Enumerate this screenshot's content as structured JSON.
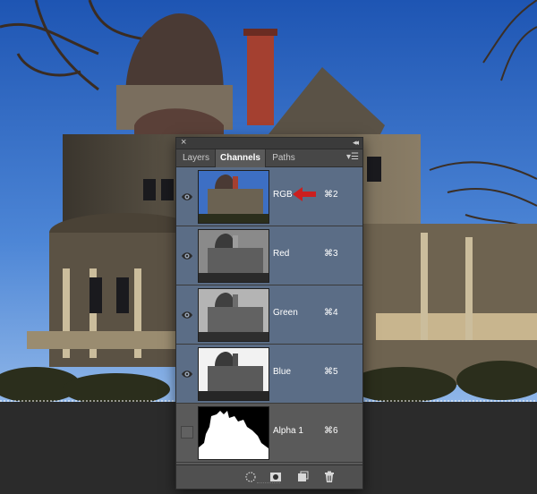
{
  "panel": {
    "tabs": [
      {
        "label": "Layers",
        "active": false
      },
      {
        "label": "Channels",
        "active": true
      },
      {
        "label": "Paths",
        "active": false
      }
    ],
    "channels": [
      {
        "name": "RGB",
        "shortcut": "⌘2",
        "visible": true,
        "selected": true
      },
      {
        "name": "Red",
        "shortcut": "⌘3",
        "visible": true,
        "selected": true
      },
      {
        "name": "Green",
        "shortcut": "⌘4",
        "visible": true,
        "selected": true
      },
      {
        "name": "Blue",
        "shortcut": "⌘5",
        "visible": true,
        "selected": true
      },
      {
        "name": "Alpha 1",
        "shortcut": "⌘6",
        "visible": false,
        "selected": false
      }
    ],
    "colors": {
      "selected_row": "#5b6d86",
      "panel_bg": "#5a5a5a",
      "annotation_arrow": "#cc1f1f"
    },
    "footer_icons": [
      "load-selection-icon",
      "save-selection-icon",
      "new-channel-icon",
      "delete-channel-icon"
    ]
  }
}
